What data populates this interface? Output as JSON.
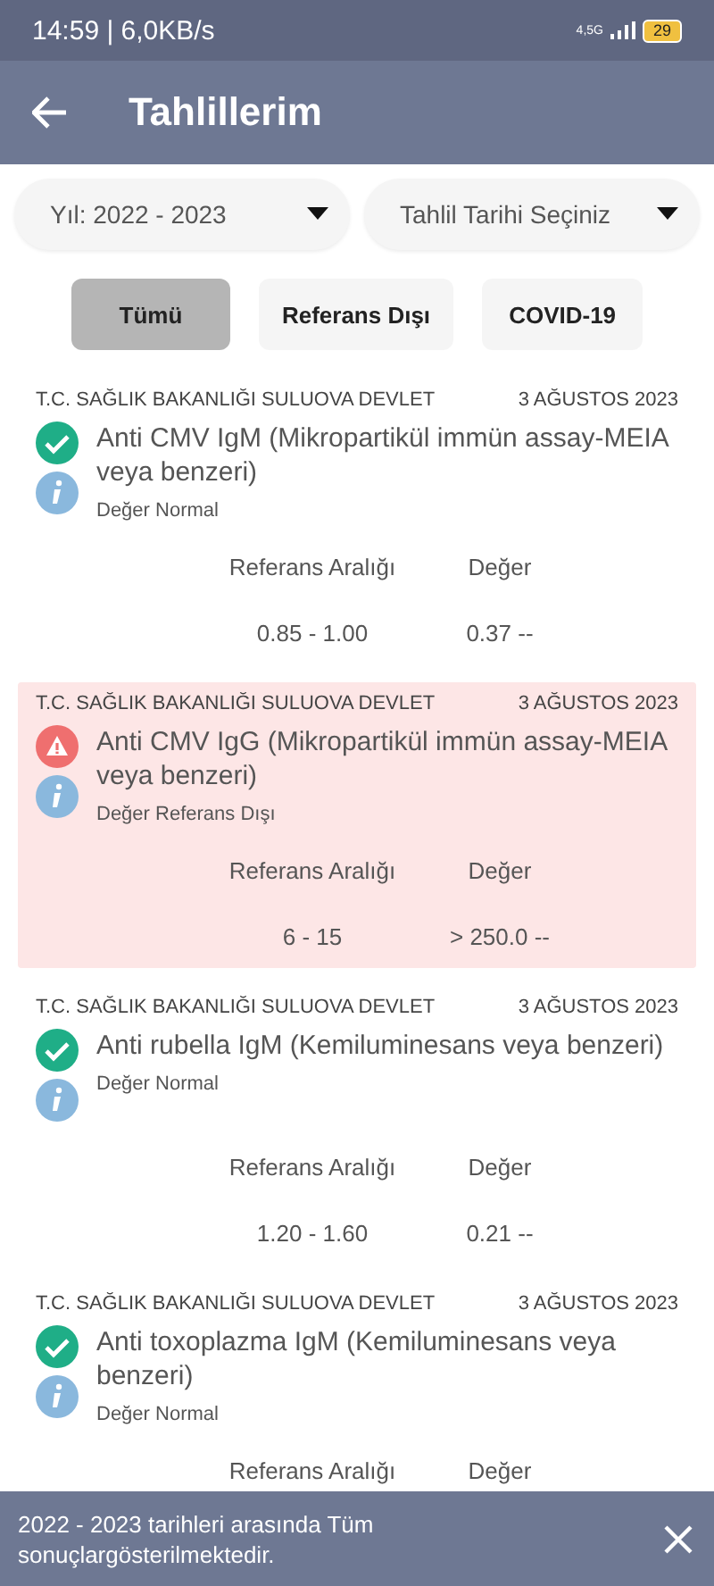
{
  "status_bar": {
    "time": "14:59 | 6,0KB/s",
    "network": "4,5G",
    "battery": "29"
  },
  "app_bar": {
    "title": "Tahlillerim"
  },
  "dropdowns": [
    {
      "value": "Yıl: 2022 - 2023"
    },
    {
      "value": "Tahlil Tarihi Seçiniz"
    }
  ],
  "filters": [
    {
      "label": "Tümü",
      "selected": true
    },
    {
      "label": "Referans Dışı",
      "selected": false
    },
    {
      "label": "COVID-19",
      "selected": false
    }
  ],
  "results": [
    {
      "institution": "T.C. SAĞLIK BAKANLIĞI SULUOVA DEVLET",
      "date": "3 AĞUSTOS 2023",
      "kind": "normal",
      "name": "Anti CMV IgM (Mikropartikül immün assay-MEIA veya benzeri)",
      "status": "Değer Normal",
      "range_label": "Referans Aralığı",
      "value_label": "Değer",
      "range": "0.85 - 1.00",
      "value": "0.37 --"
    },
    {
      "institution": "T.C. SAĞLIK BAKANLIĞI SULUOVA DEVLET",
      "date": "3 AĞUSTOS 2023",
      "kind": "out_of_range",
      "name": "Anti CMV IgG (Mikropartikül immün assay-MEIA veya benzeri)",
      "status": "Değer Referans Dışı",
      "range_label": "Referans Aralığı",
      "value_label": "Değer",
      "range": "6 - 15",
      "value": "> 250.0 --"
    },
    {
      "institution": "T.C. SAĞLIK BAKANLIĞI SULUOVA DEVLET",
      "date": "3 AĞUSTOS 2023",
      "kind": "normal",
      "name": "Anti rubella IgM (Kemiluminesans veya benzeri)",
      "status": "Değer Normal",
      "range_label": "Referans Aralığı",
      "value_label": "Değer",
      "range": "1.20 - 1.60",
      "value": "0.21 --"
    },
    {
      "institution": "T.C. SAĞLIK BAKANLIĞI SULUOVA DEVLET",
      "date": "3 AĞUSTOS 2023",
      "kind": "normal",
      "name": "Anti toxoplazma IgM (Kemiluminesans veya benzeri)",
      "status": "Değer Normal",
      "range_label": "Referans Aralığı",
      "value_label": "Değer"
    }
  ],
  "snackbar": {
    "message": "2022 - 2023 tarihleri arasında Tüm sonuçlargösterilmektedir."
  }
}
